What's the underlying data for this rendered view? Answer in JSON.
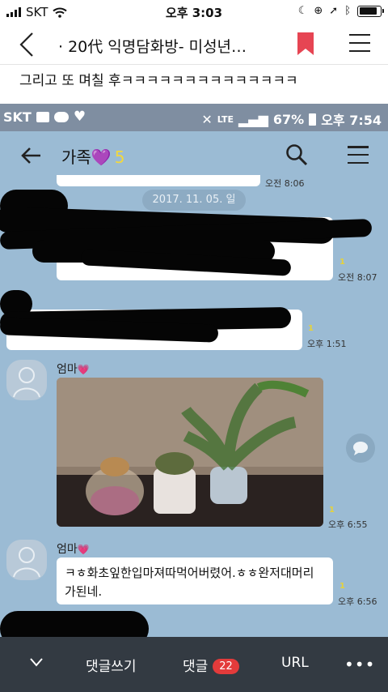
{
  "ios_status": {
    "carrier": "SKT",
    "time": "오후 3:03"
  },
  "browser_nav": {
    "title": "· 20代 익명담화방- 미성년…"
  },
  "post": {
    "text": "그리고 또 며칠 후ㅋㅋㅋㅋㅋㅋㅋㅋㅋㅋㅋㅋㅋㅋ"
  },
  "android_status": {
    "carrier": "SKT",
    "network": "LTE",
    "battery": "67%",
    "time": "오후 7:54"
  },
  "chat_header": {
    "room_name": "가족",
    "heart": "💜",
    "member_count": "5"
  },
  "date_divider": "2017. 11. 05. 일",
  "messages": {
    "m1_time": "오전 8:06",
    "m2_unread": "1",
    "m2_time": "오전 8:07",
    "m3_unread": "1",
    "m3_time": "오후 1:51",
    "m4_sender": "엄마",
    "m4_heart": "💗",
    "m4_unread": "1",
    "m4_time": "오후 6:55",
    "m5_sender": "엄마",
    "m5_heart": "💗",
    "m5_text": "ㅋㅎ화초잎한입마져따먹어버렸어.ㅎㅎ완저대머리가된네.",
    "m5_unread": "1",
    "m5_time": "오후 6:56"
  },
  "bottom_bar": {
    "write_comment": "댓글쓰기",
    "comments": "댓글",
    "comment_count": "22",
    "url": "URL",
    "more": "•••"
  },
  "colors": {
    "chat_bg": "#9bbbd4",
    "bottom_bar": "#333a42",
    "badge": "#e33b3b",
    "bookmark": "#e64553"
  }
}
